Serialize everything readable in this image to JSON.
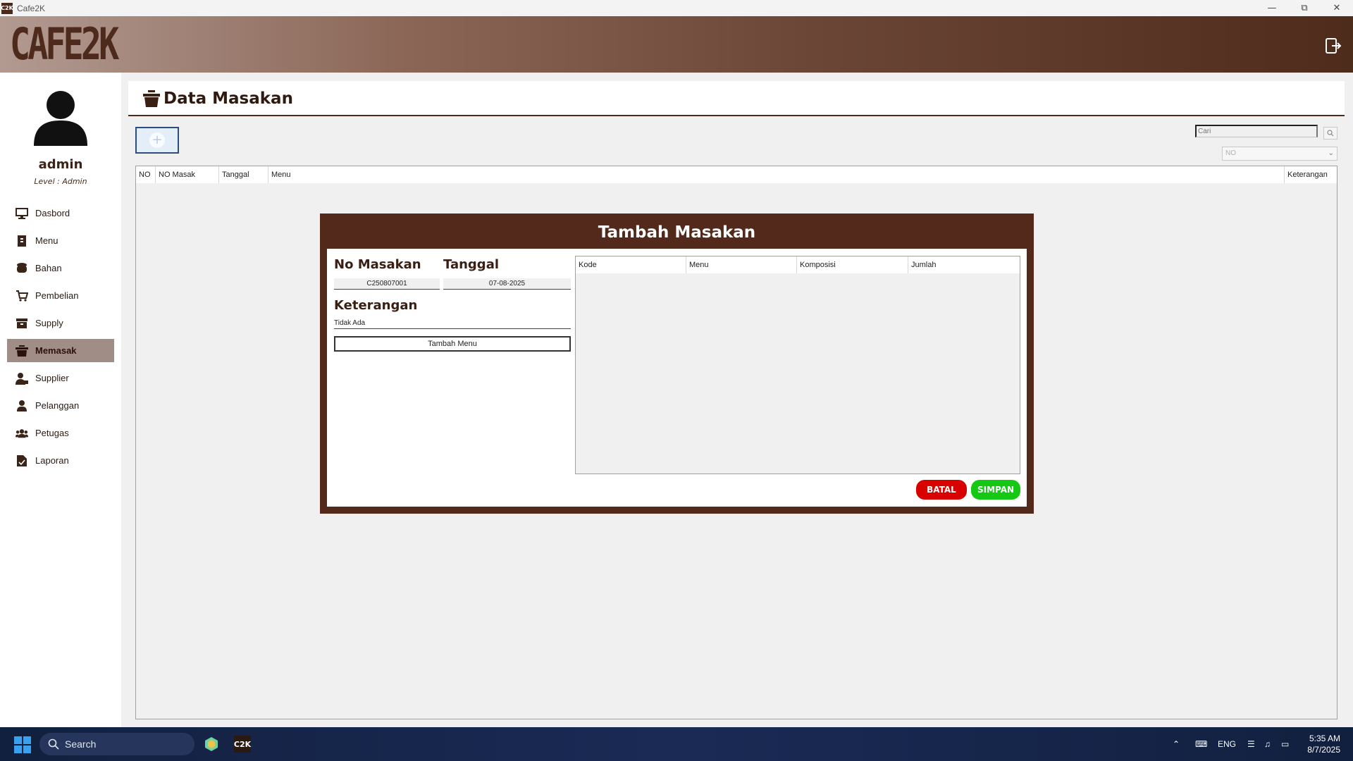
{
  "window": {
    "title": "Cafe2K",
    "app_icon": "C2K"
  },
  "header": {
    "logo": "CAFE2K",
    "logout_icon": "logout-icon"
  },
  "sidebar": {
    "username": "admin",
    "level": "Level : Admin",
    "items": [
      {
        "label": "Dasbord",
        "icon": "monitor-icon",
        "active": false
      },
      {
        "label": "Menu",
        "icon": "book-icon",
        "active": false
      },
      {
        "label": "Bahan",
        "icon": "sack-icon",
        "active": false
      },
      {
        "label": "Pembelian",
        "icon": "cart-icon",
        "active": false
      },
      {
        "label": "Supply",
        "icon": "box-icon",
        "active": true
      },
      {
        "label": "Memasak",
        "icon": "pot-icon",
        "active": true
      },
      {
        "label": "Supplier",
        "icon": "user-tie-icon",
        "active": false
      },
      {
        "label": "Pelanggan",
        "icon": "user-icon",
        "active": false
      },
      {
        "label": "Petugas",
        "icon": "users-icon",
        "active": false
      },
      {
        "label": "Laporan",
        "icon": "report-icon",
        "active": false
      }
    ]
  },
  "main": {
    "title": "Data Masakan",
    "search_placeholder": "Cari",
    "filter_selected": "NO",
    "columns": [
      "NO",
      "NO Masak",
      "Tanggal",
      "Menu",
      "Keterangan"
    ]
  },
  "modal": {
    "title": "Tambah Masakan",
    "no_masakan_label": "No Masakan",
    "no_masakan_value": "C250807001",
    "tanggal_label": "Tanggal",
    "tanggal_value": "07-08-2025",
    "keterangan_label": "Keterangan",
    "keterangan_value": "Tidak Ada",
    "tambah_menu_label": "Tambah Menu",
    "columns": [
      "Kode",
      "Menu",
      "Komposisi",
      "Jumlah"
    ],
    "batal_label": "BATAL",
    "simpan_label": "SIMPAN",
    "colors": {
      "frame": "#52291a",
      "batal": "#d90000",
      "simpan": "#14c814"
    }
  },
  "taskbar": {
    "search_label": "Search",
    "language": "ENG",
    "time": "5:35 AM",
    "date": "8/7/2025"
  }
}
